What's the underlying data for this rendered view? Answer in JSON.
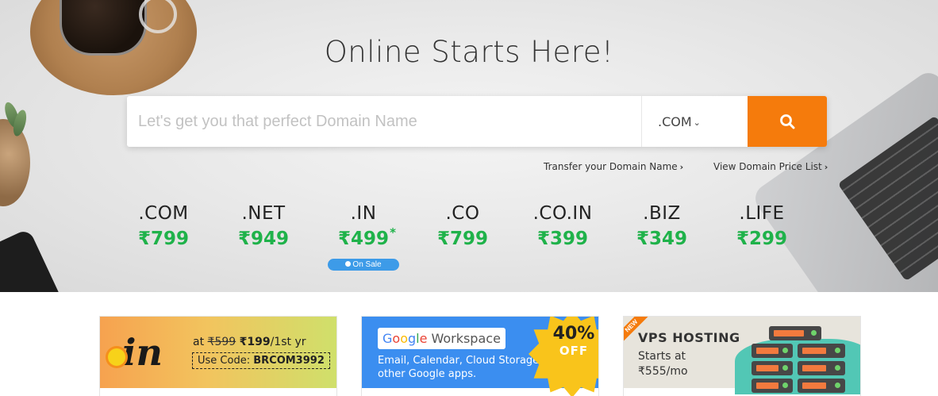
{
  "hero": {
    "title": "Online Starts Here!",
    "search": {
      "placeholder": "Let's get you that perfect Domain Name",
      "value": "",
      "tld_selected": ".COM",
      "button_icon": "search-icon"
    },
    "links": [
      {
        "label": "Transfer your Domain Name"
      },
      {
        "label": "View Domain Price List"
      }
    ],
    "tlds": [
      {
        "name": ".COM",
        "price": "₹799"
      },
      {
        "name": ".NET",
        "price": "₹949"
      },
      {
        "name": ".IN",
        "price": "₹499",
        "mark": "*"
      },
      {
        "name": ".CO",
        "price": "₹799"
      },
      {
        "name": ".CO.IN",
        "price": "₹399"
      },
      {
        "name": ".BIZ",
        "price": "₹349"
      },
      {
        "name": ".LIFE",
        "price": "₹299"
      }
    ],
    "sale_badge": "On Sale"
  },
  "cards": {
    "in_offer": {
      "logo_text": ".in",
      "at": "at",
      "old_price": "₹599",
      "new_price": "₹199",
      "period": "/1st yr",
      "code_label": "Use Code:",
      "code": "BRCOM3992"
    },
    "google": {
      "logo_letters": [
        "G",
        "o",
        "o",
        "g",
        "l",
        "e"
      ],
      "logo_suffix": "Workspace",
      "description": "Email, Calendar, Cloud Storage & other Google apps.",
      "discount_pct": "40%",
      "discount_word": "OFF"
    },
    "vps": {
      "ribbon": "NEW",
      "title": "VPS HOSTING",
      "line1": "Starts at",
      "line2": "₹555/mo"
    }
  },
  "colors": {
    "accent_orange": "#f57b0c",
    "price_green": "#1fb24a",
    "sale_blue": "#3d9be8"
  }
}
